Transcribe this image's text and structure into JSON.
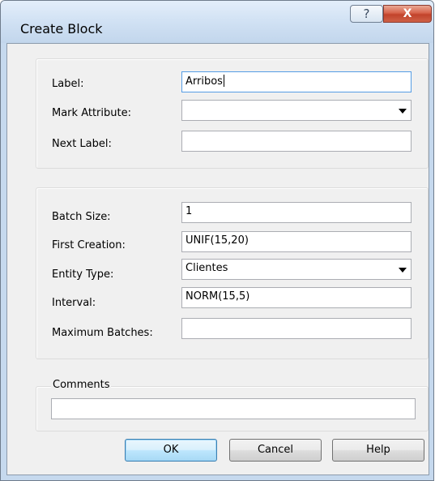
{
  "window": {
    "title": "Create Block",
    "help_glyph": "?",
    "close_glyph": "X"
  },
  "label_group": {
    "label_caption": "Label:",
    "label_value": "Arribos",
    "mark_attribute_caption": "Mark Attribute:",
    "mark_attribute_value": "",
    "next_label_caption": "Next Label:",
    "next_label_value": ""
  },
  "creation_group": {
    "batch_size_caption": "Batch Size:",
    "batch_size_value": "1",
    "first_creation_caption": "First Creation:",
    "first_creation_value": "UNIF(15,20)",
    "entity_type_caption": "Entity Type:",
    "entity_type_value": "Clientes",
    "interval_caption": "Interval:",
    "interval_value": "NORM(15,5)",
    "maximum_batches_caption": "Maximum Batches:",
    "maximum_batches_value": ""
  },
  "comments": {
    "caption": "Comments",
    "value": ""
  },
  "buttons": {
    "ok": "OK",
    "cancel": "Cancel",
    "help": "Help"
  }
}
